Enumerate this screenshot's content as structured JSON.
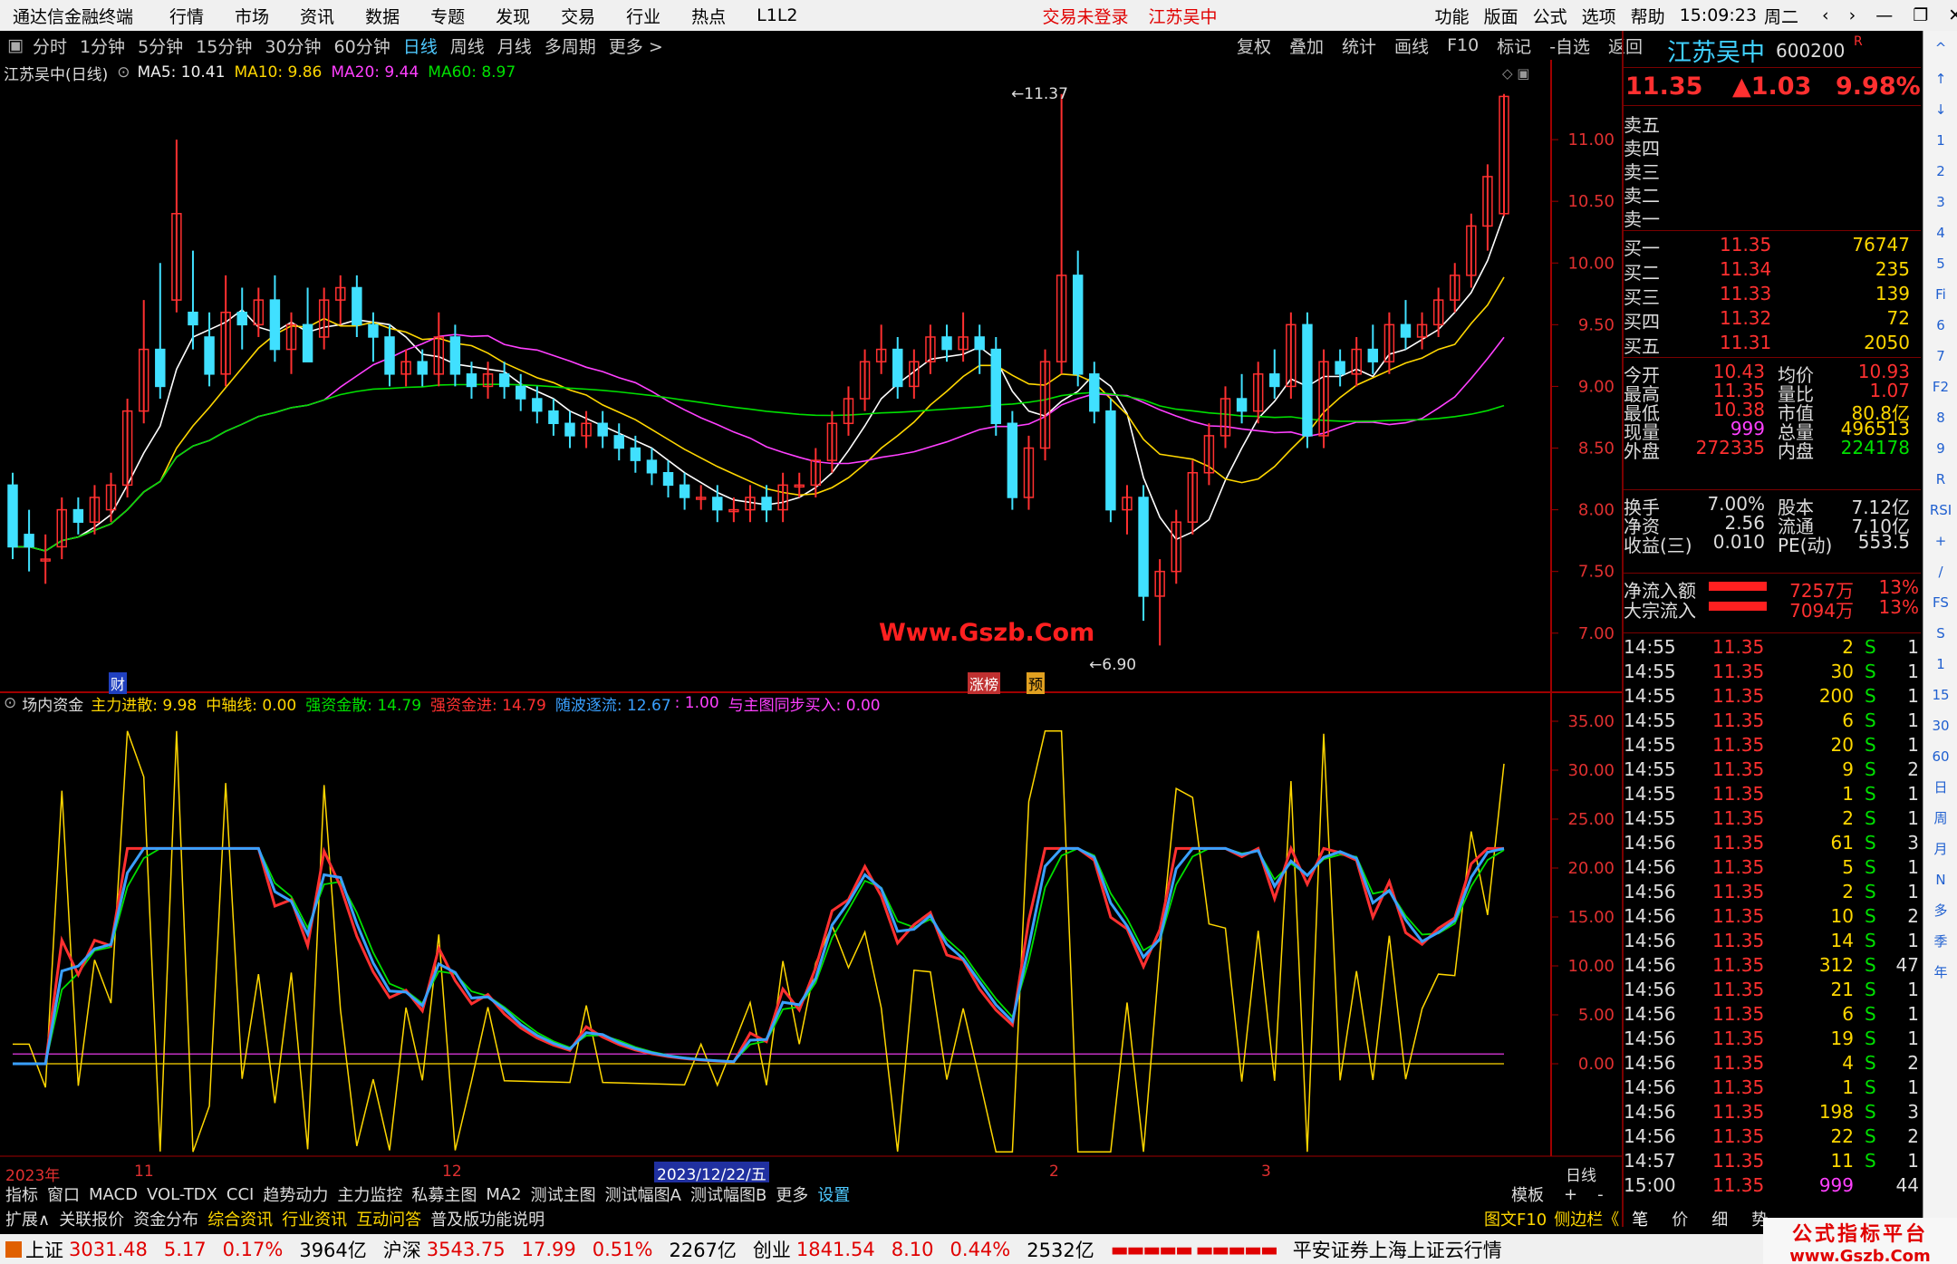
{
  "app": {
    "title": "通达信金融终端",
    "menus": [
      "行情",
      "市场",
      "资讯",
      "数据",
      "专题",
      "发现",
      "交易",
      "行业",
      "热点",
      "L1L2"
    ],
    "alerts": [
      "交易未登录",
      "江苏吴中"
    ],
    "right_menus": [
      "功能",
      "版面",
      "公式",
      "选项",
      "帮助"
    ],
    "time": "15:09:23",
    "weekday": "周二"
  },
  "toolbar": {
    "periods": [
      "分时",
      "1分钟",
      "5分钟",
      "15分钟",
      "30分钟",
      "60分钟",
      "日线",
      "周线",
      "月线",
      "多周期",
      "更多 >"
    ],
    "active": "日线",
    "right_buttons": [
      "复权",
      "叠加",
      "统计",
      "画线",
      "F10",
      "标记",
      "-自选",
      "返回"
    ]
  },
  "main_chart": {
    "stock_label": "江苏吴中(日线)",
    "ma_labels": [
      {
        "text": "MA5: 10.41",
        "color": "#ffffff"
      },
      {
        "text": "MA10: 9.86",
        "color": "#ffd700"
      },
      {
        "text": "MA20: 9.44",
        "color": "#ff40ff"
      },
      {
        "text": "MA60: 8.97",
        "color": "#00e000"
      }
    ],
    "high_label": "11.37",
    "low_label": "6.90",
    "watermark": "Www.Gszb.Com",
    "markers": [
      "财",
      "涨榜",
      "预"
    ],
    "y_ticks": [
      "11.00",
      "10.50",
      "10.00",
      "9.50",
      "9.00",
      "8.50",
      "8.00",
      "7.50",
      "7.00"
    ]
  },
  "indicator": {
    "name": "场内资金",
    "legend": [
      {
        "text": "主力进散: 9.98",
        "color": "#ffd700"
      },
      {
        "text": "中轴线: 0.00",
        "color": "#ffd700"
      },
      {
        "text": "强资金散: 14.79",
        "color": "#00e000"
      },
      {
        "text": "强资金进: 14.79",
        "color": "#ff3030"
      },
      {
        "text": "随波逐流: 12.67",
        "color": "#3aa0ff"
      },
      {
        "text": ": 1.00",
        "color": "#ff40ff"
      },
      {
        "text": "与主图同步买入: 0.00",
        "color": "#ff40ff"
      }
    ],
    "y_ticks": [
      "35.00",
      "30.00",
      "25.00",
      "20.00",
      "15.00",
      "10.00",
      "5.00",
      "0.00"
    ]
  },
  "x_axis": {
    "labels": [
      "2023年",
      "11",
      "12",
      "2",
      "3"
    ],
    "cursor_label": "2023/12/22/五",
    "period": "日线"
  },
  "chart_data": {
    "type": "candlestick",
    "ylim": [
      6.8,
      11.5
    ],
    "x": [
      "2023年",
      "11",
      "12",
      "2023/12/22/五",
      "2",
      "3"
    ],
    "ma": [
      "MA5",
      "MA10",
      "MA20",
      "MA60"
    ],
    "ohlc": [
      [
        8.2,
        8.3,
        7.6,
        7.7
      ],
      [
        7.8,
        8.0,
        7.5,
        7.7
      ],
      [
        7.6,
        7.8,
        7.4,
        7.6
      ],
      [
        7.7,
        8.1,
        7.6,
        8.0
      ],
      [
        8.0,
        8.1,
        7.8,
        7.9
      ],
      [
        7.9,
        8.2,
        7.8,
        8.1
      ],
      [
        8.0,
        8.3,
        7.9,
        8.2
      ],
      [
        8.2,
        8.9,
        8.1,
        8.8
      ],
      [
        8.8,
        9.7,
        8.7,
        9.3
      ],
      [
        9.3,
        10.0,
        8.9,
        9.0
      ],
      [
        9.7,
        11.0,
        9.6,
        10.4
      ],
      [
        9.6,
        10.1,
        9.3,
        9.5
      ],
      [
        9.4,
        9.6,
        9.0,
        9.1
      ],
      [
        9.1,
        9.9,
        9.0,
        9.6
      ],
      [
        9.6,
        9.8,
        9.3,
        9.5
      ],
      [
        9.5,
        9.8,
        9.4,
        9.7
      ],
      [
        9.7,
        9.9,
        9.2,
        9.3
      ],
      [
        9.3,
        9.6,
        9.1,
        9.5
      ],
      [
        9.5,
        9.8,
        9.2,
        9.2
      ],
      [
        9.4,
        9.8,
        9.3,
        9.7
      ],
      [
        9.7,
        9.9,
        9.5,
        9.8
      ],
      [
        9.8,
        9.9,
        9.4,
        9.5
      ],
      [
        9.5,
        9.6,
        9.2,
        9.4
      ],
      [
        9.4,
        9.5,
        9.0,
        9.1
      ],
      [
        9.1,
        9.3,
        9.0,
        9.2
      ],
      [
        9.2,
        9.3,
        9.0,
        9.1
      ],
      [
        9.1,
        9.6,
        9.0,
        9.4
      ],
      [
        9.4,
        9.5,
        9.0,
        9.1
      ],
      [
        9.1,
        9.2,
        8.9,
        9.0
      ],
      [
        9.0,
        9.2,
        8.9,
        9.1
      ],
      [
        9.1,
        9.2,
        8.9,
        9.0
      ],
      [
        9.0,
        9.1,
        8.8,
        8.9
      ],
      [
        8.9,
        9.0,
        8.7,
        8.8
      ],
      [
        8.8,
        8.9,
        8.6,
        8.7
      ],
      [
        8.7,
        8.8,
        8.5,
        8.6
      ],
      [
        8.6,
        8.8,
        8.5,
        8.7
      ],
      [
        8.7,
        8.8,
        8.5,
        8.6
      ],
      [
        8.6,
        8.7,
        8.4,
        8.5
      ],
      [
        8.5,
        8.6,
        8.3,
        8.4
      ],
      [
        8.4,
        8.5,
        8.2,
        8.3
      ],
      [
        8.3,
        8.4,
        8.1,
        8.2
      ],
      [
        8.2,
        8.3,
        8.0,
        8.1
      ],
      [
        8.1,
        8.2,
        8.0,
        8.1
      ],
      [
        8.1,
        8.2,
        7.9,
        8.0
      ],
      [
        8.0,
        8.1,
        7.9,
        8.0
      ],
      [
        8.0,
        8.2,
        7.9,
        8.1
      ],
      [
        8.1,
        8.2,
        7.9,
        8.0
      ],
      [
        8.0,
        8.3,
        7.9,
        8.2
      ],
      [
        8.2,
        8.3,
        8.1,
        8.2
      ],
      [
        8.2,
        8.5,
        8.1,
        8.4
      ],
      [
        8.4,
        8.8,
        8.3,
        8.7
      ],
      [
        8.7,
        9.0,
        8.6,
        8.9
      ],
      [
        8.9,
        9.3,
        8.8,
        9.2
      ],
      [
        9.2,
        9.5,
        9.1,
        9.3
      ],
      [
        9.3,
        9.4,
        8.9,
        9.0
      ],
      [
        9.0,
        9.3,
        8.9,
        9.2
      ],
      [
        9.2,
        9.5,
        9.1,
        9.4
      ],
      [
        9.4,
        9.5,
        9.2,
        9.3
      ],
      [
        9.3,
        9.6,
        9.2,
        9.4
      ],
      [
        9.4,
        9.5,
        9.1,
        9.3
      ],
      [
        9.3,
        9.4,
        8.6,
        8.7
      ],
      [
        8.7,
        8.8,
        8.0,
        8.1
      ],
      [
        8.1,
        8.6,
        8.0,
        8.5
      ],
      [
        8.5,
        9.3,
        8.4,
        9.2
      ],
      [
        9.2,
        11.37,
        9.1,
        9.9
      ],
      [
        9.9,
        10.1,
        9.0,
        9.1
      ],
      [
        9.1,
        9.2,
        8.7,
        8.8
      ],
      [
        8.8,
        8.9,
        7.9,
        8.0
      ],
      [
        8.0,
        8.2,
        7.8,
        8.1
      ],
      [
        8.1,
        8.2,
        7.1,
        7.3
      ],
      [
        7.3,
        7.6,
        6.9,
        7.5
      ],
      [
        7.5,
        8.0,
        7.4,
        7.9
      ],
      [
        7.9,
        8.4,
        7.8,
        8.3
      ],
      [
        8.3,
        8.7,
        8.2,
        8.6
      ],
      [
        8.6,
        9.0,
        8.5,
        8.9
      ],
      [
        8.9,
        9.1,
        8.7,
        8.8
      ],
      [
        8.8,
        9.2,
        8.7,
        9.1
      ],
      [
        9.1,
        9.3,
        8.9,
        9.0
      ],
      [
        9.0,
        9.6,
        8.9,
        9.5
      ],
      [
        9.5,
        9.6,
        8.5,
        8.6
      ],
      [
        8.6,
        9.3,
        8.5,
        9.2
      ],
      [
        9.2,
        9.3,
        9.0,
        9.1
      ],
      [
        9.1,
        9.4,
        9.0,
        9.3
      ],
      [
        9.3,
        9.5,
        9.1,
        9.2
      ],
      [
        9.2,
        9.6,
        9.1,
        9.5
      ],
      [
        9.5,
        9.7,
        9.3,
        9.4
      ],
      [
        9.4,
        9.6,
        9.3,
        9.5
      ],
      [
        9.5,
        9.8,
        9.4,
        9.7
      ],
      [
        9.7,
        10.0,
        9.6,
        9.9
      ],
      [
        9.9,
        10.4,
        9.8,
        10.3
      ],
      [
        10.3,
        10.8,
        10.1,
        10.7
      ],
      [
        10.4,
        11.37,
        10.38,
        11.35
      ]
    ],
    "values_ma5": [],
    "indicator_series": [
      "主力进散",
      "强资金进",
      "随波逐流",
      "强资金散",
      "中轴线"
    ]
  },
  "quote": {
    "name": "江苏吴中",
    "code": "600200",
    "flag": "R",
    "price": "11.35",
    "change": "▲1.03",
    "pct": "9.98%",
    "sell": [
      {
        "label": "卖五",
        "p": "",
        "v": ""
      },
      {
        "label": "卖四",
        "p": "",
        "v": ""
      },
      {
        "label": "卖三",
        "p": "",
        "v": ""
      },
      {
        "label": "卖二",
        "p": "",
        "v": ""
      },
      {
        "label": "卖一",
        "p": "",
        "v": ""
      }
    ],
    "buy": [
      {
        "label": "买一",
        "p": "11.35",
        "v": "76747"
      },
      {
        "label": "买二",
        "p": "11.34",
        "v": "235"
      },
      {
        "label": "买三",
        "p": "11.33",
        "v": "139"
      },
      {
        "label": "买四",
        "p": "11.32",
        "v": "72"
      },
      {
        "label": "买五",
        "p": "11.31",
        "v": "2050"
      }
    ],
    "stats1": [
      [
        "今开",
        "10.43",
        "均价",
        "10.93"
      ],
      [
        "最高",
        "11.35",
        "量比",
        "1.07"
      ],
      [
        "最低",
        "10.38",
        "市值",
        "80.8亿"
      ],
      [
        "现量",
        "999",
        "总量",
        "496513"
      ],
      [
        "外盘",
        "272335",
        "内盘",
        "224178"
      ]
    ],
    "stats2": [
      [
        "换手",
        "7.00%",
        "股本",
        "7.12亿"
      ],
      [
        "净资",
        "2.56",
        "流通",
        "7.10亿"
      ],
      [
        "收益(三)",
        "0.010",
        "PE(动)",
        "553.5"
      ]
    ],
    "flows": [
      [
        "净流入额",
        "7257万",
        "13%"
      ],
      [
        "大宗流入",
        "7094万",
        "13%"
      ]
    ]
  },
  "ticks": [
    [
      "14:55",
      "11.35",
      "2",
      "S",
      "1"
    ],
    [
      "14:55",
      "11.35",
      "30",
      "S",
      "1"
    ],
    [
      "14:55",
      "11.35",
      "200",
      "S",
      "1"
    ],
    [
      "14:55",
      "11.35",
      "6",
      "S",
      "1"
    ],
    [
      "14:55",
      "11.35",
      "20",
      "S",
      "1"
    ],
    [
      "14:55",
      "11.35",
      "9",
      "S",
      "2"
    ],
    [
      "14:55",
      "11.35",
      "1",
      "S",
      "1"
    ],
    [
      "14:55",
      "11.35",
      "2",
      "S",
      "1"
    ],
    [
      "14:56",
      "11.35",
      "61",
      "S",
      "3"
    ],
    [
      "14:56",
      "11.35",
      "5",
      "S",
      "1"
    ],
    [
      "14:56",
      "11.35",
      "2",
      "S",
      "1"
    ],
    [
      "14:56",
      "11.35",
      "10",
      "S",
      "2"
    ],
    [
      "14:56",
      "11.35",
      "14",
      "S",
      "1"
    ],
    [
      "14:56",
      "11.35",
      "312",
      "S",
      "47"
    ],
    [
      "14:56",
      "11.35",
      "21",
      "S",
      "1"
    ],
    [
      "14:56",
      "11.35",
      "6",
      "S",
      "1"
    ],
    [
      "14:56",
      "11.35",
      "19",
      "S",
      "1"
    ],
    [
      "14:56",
      "11.35",
      "4",
      "S",
      "2"
    ],
    [
      "14:56",
      "11.35",
      "1",
      "S",
      "1"
    ],
    [
      "14:56",
      "11.35",
      "198",
      "S",
      "3"
    ],
    [
      "14:56",
      "11.35",
      "22",
      "S",
      "2"
    ],
    [
      "14:57",
      "11.35",
      "11",
      "S",
      "1"
    ],
    [
      "15:00",
      "11.35",
      "999",
      "",
      "44"
    ]
  ],
  "bottom_tabs": [
    "指标",
    "窗口",
    "MACD",
    "VOL-TDX",
    "CCI",
    "趋势动力",
    "主力监控",
    "私募主图",
    "MA2",
    "测试主图",
    "测试幅图A",
    "测试幅图B",
    "更多",
    "设置"
  ],
  "bottom_tabs_right": [
    "模板",
    "+",
    "-"
  ],
  "bottom_tabs2": [
    {
      "t": "扩展∧",
      "c": "#ddd"
    },
    {
      "t": "关联报价",
      "c": "#ddd"
    },
    {
      "t": "资金分布",
      "c": "#ddd"
    },
    {
      "t": "综合资讯",
      "c": "#ffd700"
    },
    {
      "t": "行业资讯",
      "c": "#ffd700"
    },
    {
      "t": "互动问答",
      "c": "#ffd700"
    },
    {
      "t": "普及版功能说明",
      "c": "#ddd"
    }
  ],
  "bottom_right2": [
    "图文F10",
    "侧边栏《",
    "笔",
    "价",
    "细",
    "势"
  ],
  "status": {
    "indices": [
      {
        "name": "上证",
        "v": "3031.48",
        "c": "5.17",
        "p": "0.17%",
        "amt": "3964亿"
      },
      {
        "name": "沪深",
        "v": "3543.75",
        "c": "17.99",
        "p": "0.51%",
        "amt": "2267亿"
      },
      {
        "name": "创业",
        "v": "1841.54",
        "c": "8.10",
        "p": "0.44%",
        "amt": "2532亿"
      }
    ],
    "broker": "平安证券上海上证云行情",
    "logo": "公式指标平台",
    "logo2": "www.Gszb.Com"
  },
  "side_icons": [
    "^",
    "↑",
    "↓",
    "1",
    "2",
    "3",
    "4",
    "5",
    "Fi",
    "6",
    "7",
    "F2",
    "8",
    "9",
    "R",
    "RSI",
    "+",
    "/",
    "FS",
    "S",
    "1",
    "15",
    "30",
    "60",
    "日",
    "周",
    "月",
    "N",
    "多",
    "季",
    "年"
  ]
}
